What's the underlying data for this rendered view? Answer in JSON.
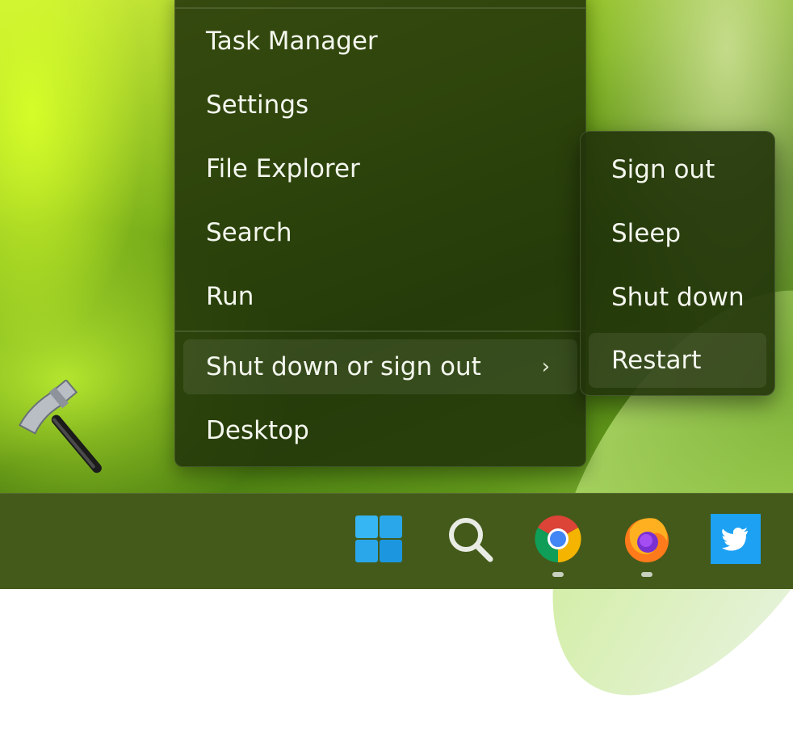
{
  "context_menu": {
    "items": [
      {
        "label": "Task Manager"
      },
      {
        "label": "Settings"
      },
      {
        "label": "File Explorer"
      },
      {
        "label": "Search"
      },
      {
        "label": "Run"
      },
      {
        "label": "Shut down or sign out",
        "has_submenu": true
      },
      {
        "label": "Desktop"
      }
    ],
    "highlighted_item": "Shut down or sign out",
    "chevron_glyph": "›"
  },
  "submenu": {
    "items": [
      {
        "label": "Sign out"
      },
      {
        "label": "Sleep"
      },
      {
        "label": "Shut down"
      },
      {
        "label": "Restart"
      }
    ],
    "highlighted_item": "Restart"
  },
  "taskbar": {
    "icons": [
      {
        "name": "windows-start-icon",
        "running": false
      },
      {
        "name": "search-icon",
        "running": false
      },
      {
        "name": "chrome-icon",
        "running": true
      },
      {
        "name": "firefox-icon",
        "running": true
      },
      {
        "name": "twitter-icon",
        "running": false
      }
    ]
  },
  "colors": {
    "menu_bg": "#22340a",
    "taskbar_bg": "#445a1a",
    "text": "#f4f7ee",
    "windows_blue": "#2fb1f0",
    "twitter_blue": "#1da1f2"
  }
}
